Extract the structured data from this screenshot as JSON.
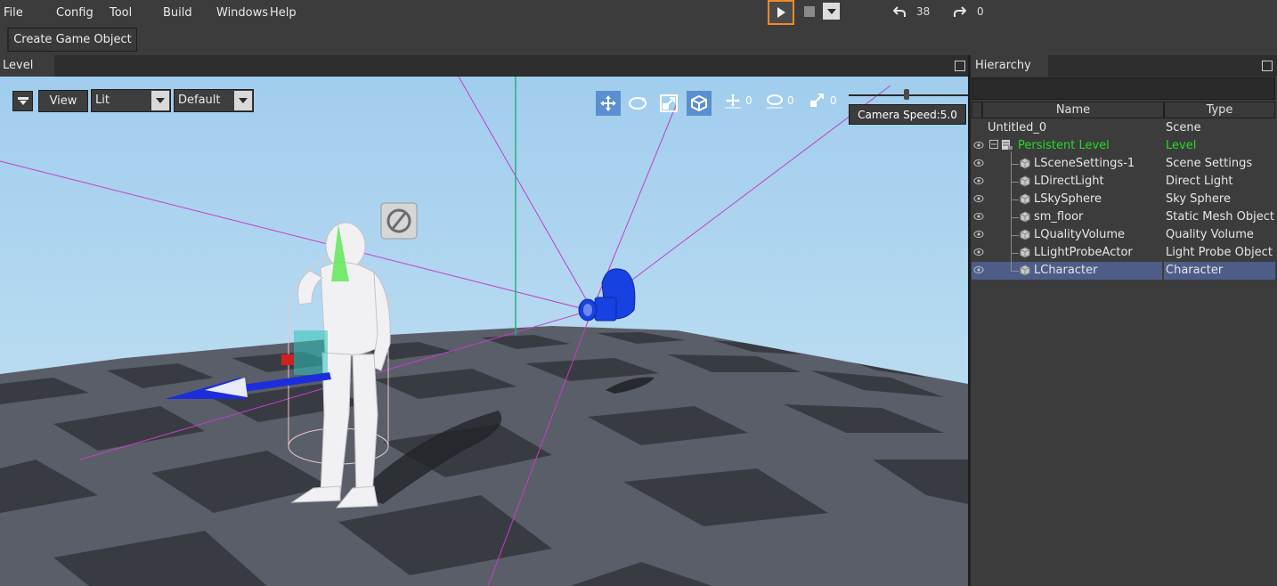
{
  "menubar": {
    "items": [
      "File",
      "Config",
      "Tool",
      "Build",
      "Windows",
      "Help"
    ],
    "undo_count": "38",
    "redo_count": "0"
  },
  "toolbar": {
    "create_game_object": "Create Game Object"
  },
  "level_panel": {
    "tab_title": "Level",
    "view_button": "View",
    "render_mode": "Lit",
    "layout_mode": "Default",
    "snap_translate": "0",
    "snap_rotate": "0",
    "snap_scale": "0",
    "camera_speed_label": "Camera Speed:5.0"
  },
  "hierarchy": {
    "tab_title": "Hierarchy",
    "columns": {
      "name": "Name",
      "type": "Type"
    },
    "rows": [
      {
        "name": "Untitled_0",
        "type": "Scene"
      },
      {
        "name": "Persistent Level",
        "type": "Level"
      },
      {
        "name": "LSceneSettings-1",
        "type": "Scene Settings"
      },
      {
        "name": "LDirectLight",
        "type": "Direct Light"
      },
      {
        "name": "LSkySphere",
        "type": "Sky Sphere"
      },
      {
        "name": "sm_floor",
        "type": "Static Mesh Object"
      },
      {
        "name": "LQualityVolume",
        "type": "Quality Volume"
      },
      {
        "name": "LLightProbeActor",
        "type": "Light Probe Object"
      },
      {
        "name": "LCharacter",
        "type": "Character"
      }
    ],
    "selected": "LCharacter"
  },
  "colors": {
    "accent_play_border": "#f0882a",
    "level_text": "#22dd22",
    "selection": "#4e5d88",
    "sky": "#a9d3ee"
  },
  "icons": {
    "play": "play-icon",
    "stop": "stop-icon",
    "undo": "undo-icon",
    "redo": "redo-icon",
    "translate": "move-gizmo-icon",
    "rotate": "rotate-gizmo-icon",
    "scale": "scale-gizmo-icon",
    "local": "local-space-icon",
    "visibility": "eye-icon",
    "object": "cube-icon"
  }
}
